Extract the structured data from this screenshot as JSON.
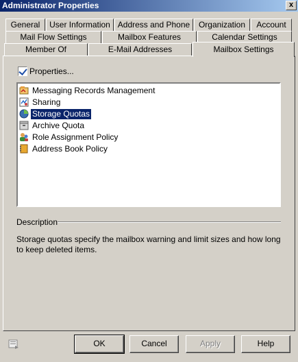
{
  "window": {
    "title": "Administrator Properties",
    "close_glyph": "x"
  },
  "tabs": {
    "row1": [
      "General",
      "User Information",
      "Address and Phone",
      "Organization",
      "Account"
    ],
    "row2": [
      "Mail Flow Settings",
      "Mailbox Features",
      "Calendar Settings"
    ],
    "row3": [
      "Member Of",
      "E-Mail Addresses",
      "Mailbox Settings"
    ],
    "active": "Mailbox Settings"
  },
  "properties": {
    "label": "Properties...",
    "checked": true
  },
  "list": {
    "items": [
      {
        "label": "Messaging Records Management",
        "icon": "records-management-icon"
      },
      {
        "label": "Sharing",
        "icon": "sharing-icon"
      },
      {
        "label": "Storage Quotas",
        "icon": "storage-quotas-icon",
        "selected": true
      },
      {
        "label": "Archive Quota",
        "icon": "archive-quota-icon"
      },
      {
        "label": "Role Assignment Policy",
        "icon": "role-assignment-icon"
      },
      {
        "label": "Address Book Policy",
        "icon": "address-book-icon"
      }
    ]
  },
  "description": {
    "heading": "Description",
    "text": "Storage quotas specify the mailbox warning and limit sizes and how long to keep deleted items."
  },
  "buttons": {
    "ok": "OK",
    "cancel": "Cancel",
    "apply": "Apply",
    "help": "Help"
  },
  "colors": {
    "titlebar": "#0a246a",
    "selection": "#0a246a",
    "face": "#d4d0c8"
  }
}
